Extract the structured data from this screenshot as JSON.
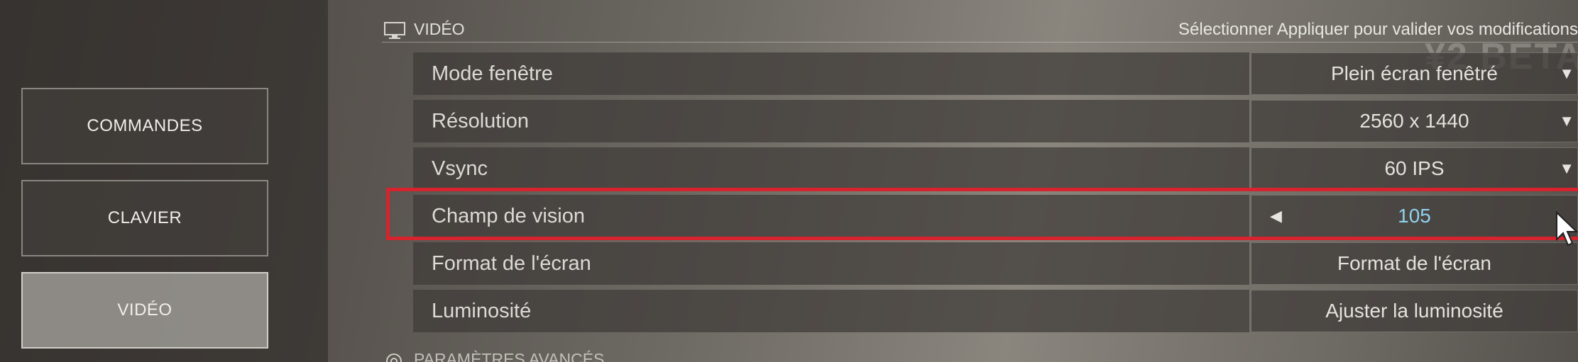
{
  "sidebar": {
    "items": [
      {
        "label": "COMMANDES",
        "active": false
      },
      {
        "label": "CLAVIER",
        "active": false
      },
      {
        "label": "VIDÉO",
        "active": true
      }
    ]
  },
  "section": {
    "title": "VIDÉO",
    "hint": "Sélectionner Appliquer pour valider vos modifications",
    "icon": "monitor-icon"
  },
  "watermark": "¥2 BETA",
  "settings": [
    {
      "label": "Mode fenêtre",
      "value": "Plein écran fenêtré",
      "control": "dropdown"
    },
    {
      "label": "Résolution",
      "value": "2560 x 1440",
      "control": "dropdown"
    },
    {
      "label": "Vsync",
      "value": "60 IPS",
      "control": "dropdown"
    },
    {
      "label": "Champ de vision",
      "value": "105",
      "control": "slider",
      "selected": true
    },
    {
      "label": "Format de l'écran",
      "value": "Format de l'écran",
      "control": "button"
    },
    {
      "label": "Luminosité",
      "value": "Ajuster la luminosité",
      "control": "button"
    }
  ],
  "advanced": {
    "title": "PARAMÈTRES AVANCÉS",
    "icon": "gear-icon"
  },
  "colors": {
    "highlight": "#d6232d",
    "fov_value": "#8fd2ef"
  }
}
